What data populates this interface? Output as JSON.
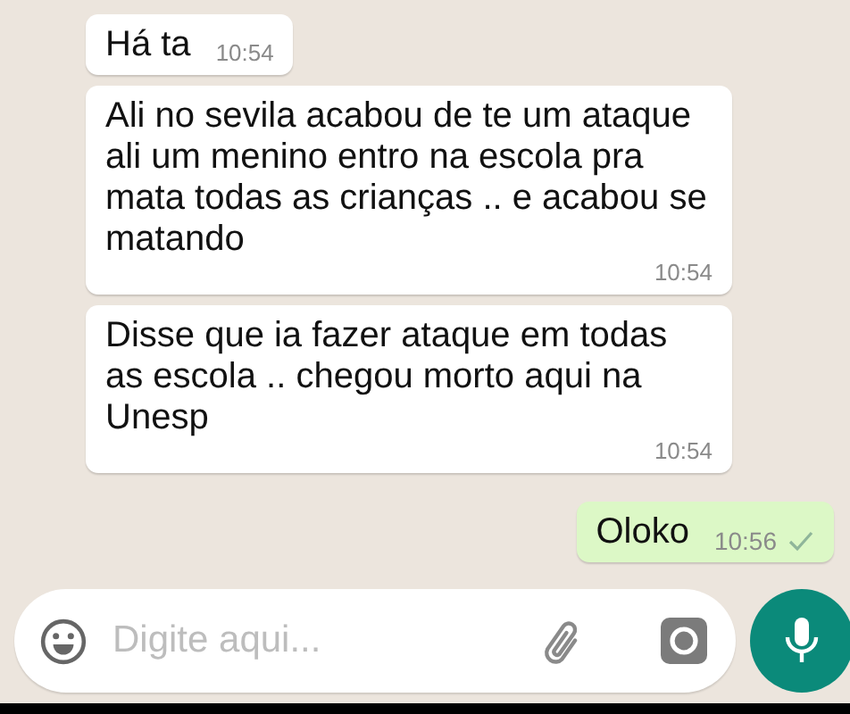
{
  "messages": [
    {
      "kind": "incoming",
      "text": "Há ta",
      "time": "10:54"
    },
    {
      "kind": "incoming",
      "text": "Ali no sevila acabou de te um ataque ali um menino entro na escola pra mata todas as crianças .. e acabou se matando",
      "time": "10:54"
    },
    {
      "kind": "incoming",
      "text": "Disse que ia fazer ataque em todas as escola .. chegou morto aqui na Unesp",
      "time": "10:54"
    },
    {
      "kind": "outgoing",
      "text": "Oloko",
      "time": "10:56",
      "sent": true
    }
  ],
  "composer": {
    "placeholder": "Digite aqui..."
  }
}
